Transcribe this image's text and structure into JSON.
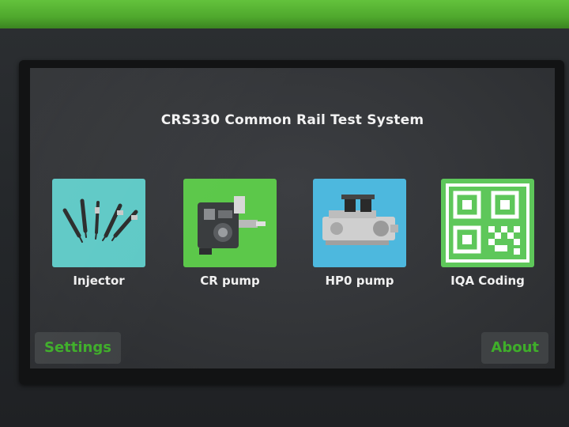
{
  "app": {
    "title": "CRS330 Common Rail Test System"
  },
  "menu": {
    "items": [
      {
        "label": "Injector",
        "icon": "injector-icon",
        "color": "#5fc9c6"
      },
      {
        "label": "CR pump",
        "icon": "cr-pump-icon",
        "color": "#5cc84a"
      },
      {
        "label": "HP0 pump",
        "icon": "hp0-pump-icon",
        "color": "#4db8de"
      },
      {
        "label": "IQA Coding",
        "icon": "qr-code-icon",
        "color": "#5ec75a"
      }
    ]
  },
  "footer": {
    "settings_label": "Settings",
    "about_label": "About",
    "accent_color": "#3fae2a"
  }
}
